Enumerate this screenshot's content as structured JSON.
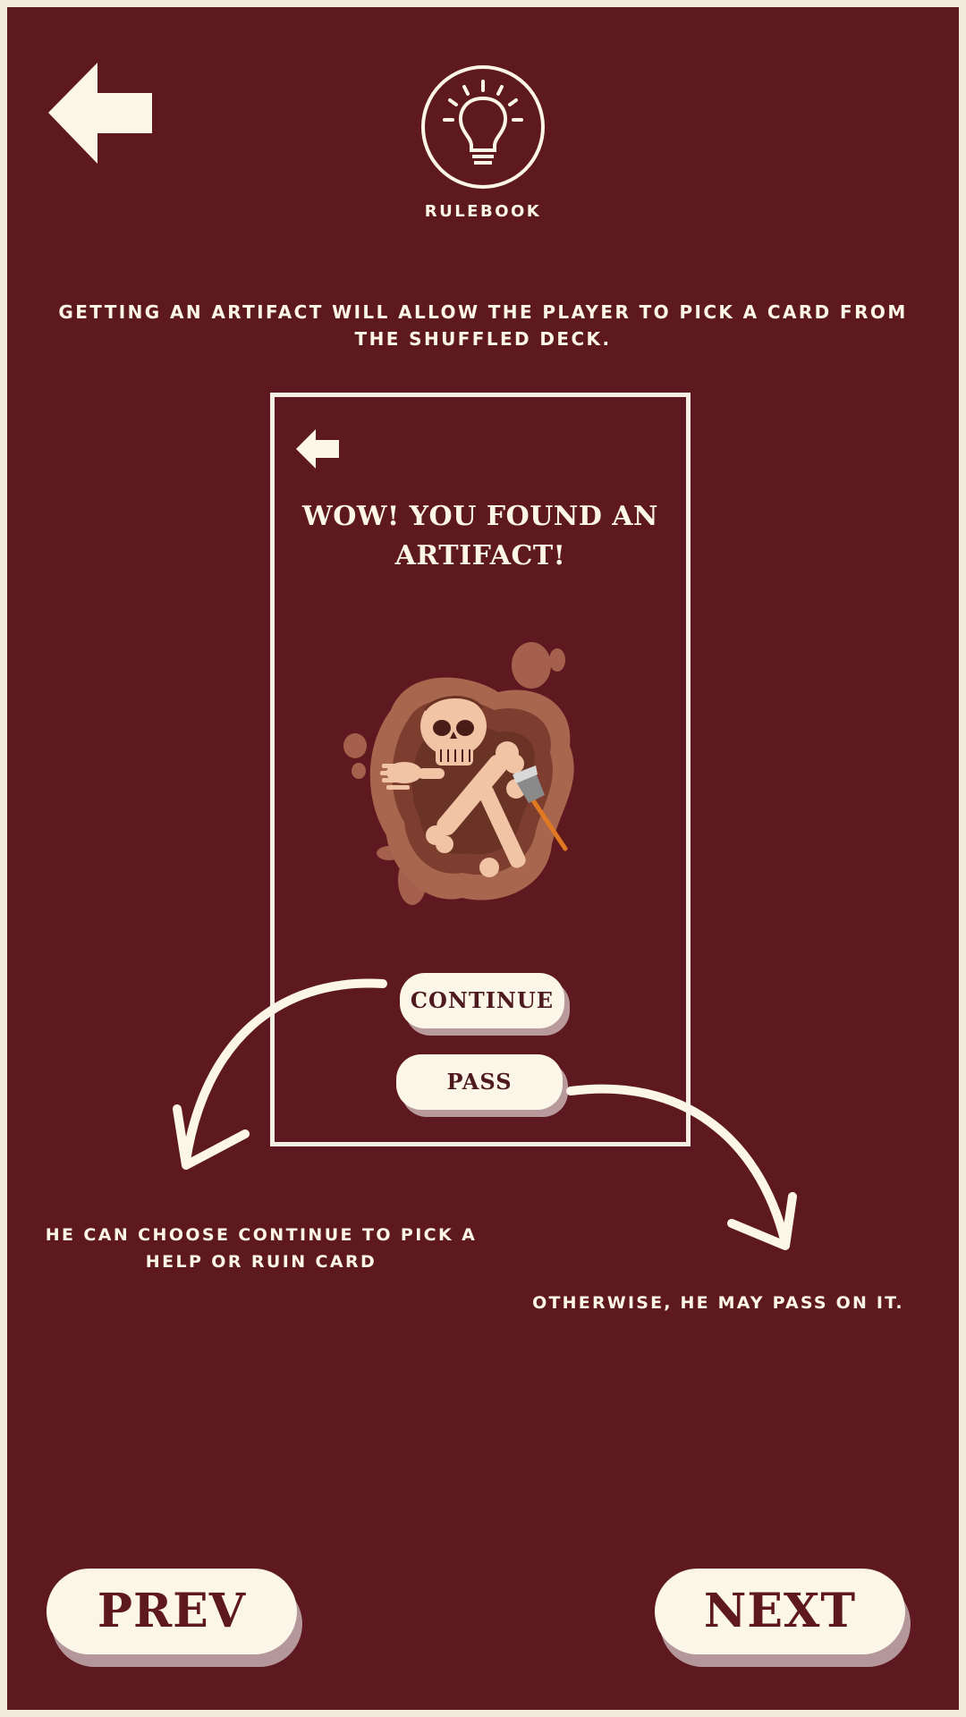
{
  "header": {
    "back_icon": "left-arrow-icon",
    "rulebook_icon": "lightbulb-icon",
    "rulebook_label": "RULEBOOK"
  },
  "intro_text": "GETTING AN ARTIFACT WILL ALLOW THE PLAYER TO PICK A CARD FROM THE SHUFFLED DECK.",
  "screen_preview": {
    "back_icon": "left-arrow-icon",
    "title_line1": "WOW! YOU FOUND AN",
    "title_line2": "ARTIFACT!",
    "illustration": "excavated-skeleton-artifact",
    "continue_label": "CONTINUE",
    "pass_label": "PASS"
  },
  "captions": {
    "continue_line1": "HE CAN CHOOSE CONTINUE TO PICK A",
    "continue_line2": "HELP OR RUIN CARD",
    "pass": "OTHERWISE, HE MAY PASS ON IT."
  },
  "nav": {
    "prev_label": "PREV",
    "next_label": "NEXT"
  },
  "colors": {
    "background": "#5e1920",
    "cream": "#fbf6e8",
    "button_shadow": "#b3979a"
  }
}
